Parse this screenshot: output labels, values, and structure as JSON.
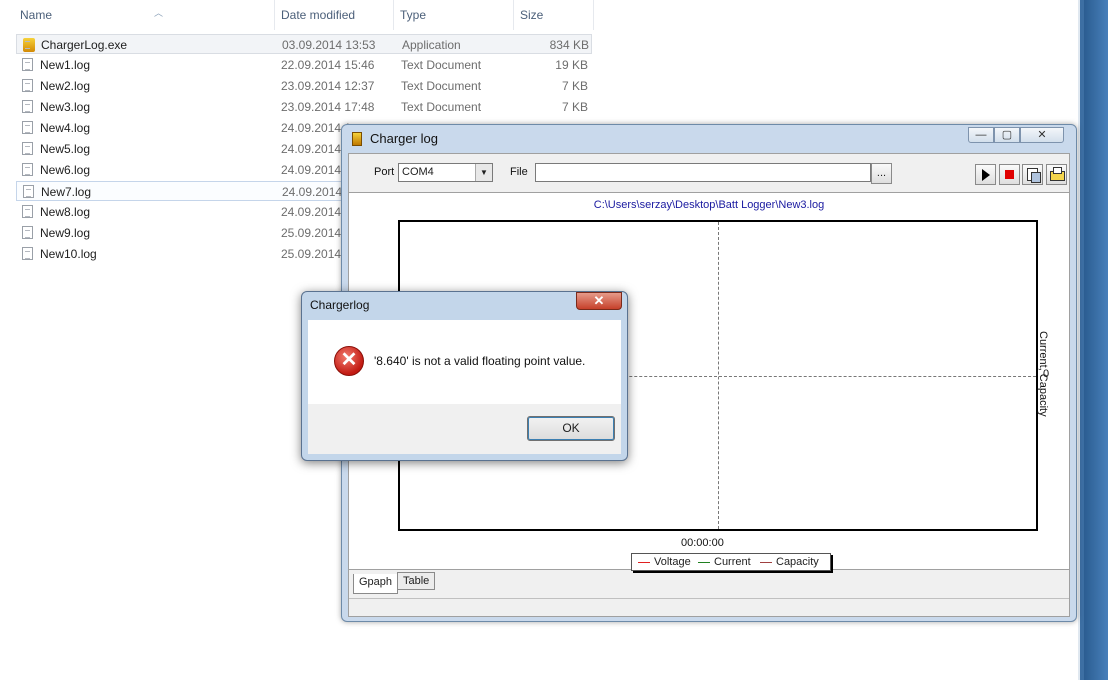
{
  "explorer": {
    "columns": {
      "name": "Name",
      "date": "Date modified",
      "type": "Type",
      "size": "Size"
    },
    "files": [
      {
        "name": "ChargerLog.exe",
        "date": "03.09.2014 13:53",
        "type": "Application",
        "size": "834 KB",
        "icon": "exe-icon"
      },
      {
        "name": "New1.log",
        "date": "22.09.2014 15:46",
        "type": "Text Document",
        "size": "19 KB",
        "icon": "text-file-icon"
      },
      {
        "name": "New2.log",
        "date": "23.09.2014 12:37",
        "type": "Text Document",
        "size": "7 KB",
        "icon": "text-file-icon"
      },
      {
        "name": "New3.log",
        "date": "23.09.2014 17:48",
        "type": "Text Document",
        "size": "7 KB",
        "icon": "text-file-icon"
      },
      {
        "name": "New4.log",
        "date": "24.09.2014 1",
        "type": "",
        "size": "",
        "icon": "text-file-icon"
      },
      {
        "name": "New5.log",
        "date": "24.09.2014 1",
        "type": "",
        "size": "",
        "icon": "text-file-icon"
      },
      {
        "name": "New6.log",
        "date": "24.09.2014 1",
        "type": "",
        "size": "",
        "icon": "text-file-icon"
      },
      {
        "name": "New7.log",
        "date": "24.09.2014 1",
        "type": "",
        "size": "",
        "icon": "text-file-icon"
      },
      {
        "name": "New8.log",
        "date": "24.09.2014 1",
        "type": "",
        "size": "",
        "icon": "text-file-icon"
      },
      {
        "name": "New9.log",
        "date": "25.09.2014 1",
        "type": "",
        "size": "",
        "icon": "text-file-icon"
      },
      {
        "name": "New10.log",
        "date": "25.09.2014 1",
        "type": "",
        "size": "",
        "icon": "text-file-icon"
      }
    ]
  },
  "app": {
    "title": "Charger log",
    "window_controls": {
      "minimize": "—",
      "maximize": "▢",
      "close": "✕"
    },
    "toolbar": {
      "port_label": "Port",
      "port_value": "COM4",
      "file_label": "File",
      "file_value": "",
      "browse_label": "..."
    },
    "chart_path": "C:\\Users\\serzay\\Desktop\\Batt Logger\\New3.log",
    "tabs": [
      "Gpaph",
      "Table"
    ]
  },
  "chart_data": {
    "type": "line",
    "x_ticks": [
      "00:00:00"
    ],
    "y_ticks": [
      "0"
    ],
    "ylabel": "Current, Capacity",
    "series": [
      {
        "name": "Voltage",
        "values": [],
        "color": "#e02020"
      },
      {
        "name": "Current",
        "values": [],
        "color": "#208020"
      },
      {
        "name": "Capacity",
        "values": [],
        "color": "#a04040"
      }
    ],
    "grid": "dashed center lines"
  },
  "dialog": {
    "title": "Chargerlog",
    "close_label": "✕",
    "icon": "error-icon",
    "message": "'8.640' is not a valid floating point value.",
    "ok_label": "OK"
  }
}
